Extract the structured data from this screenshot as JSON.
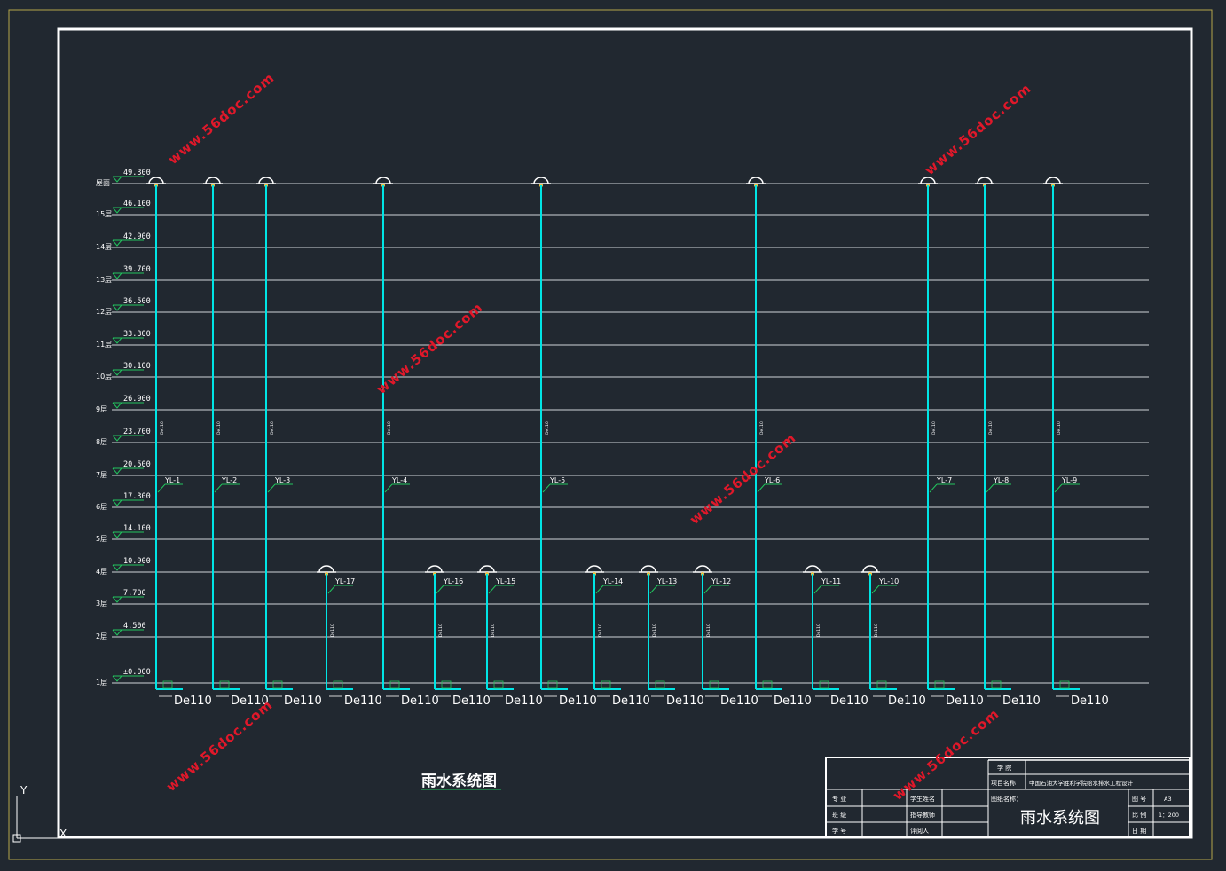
{
  "title": "雨水系统图",
  "elev_labels": [
    "49.300",
    "46.100",
    "42.900",
    "39.700",
    "36.500",
    "33.300",
    "30.100",
    "26.900",
    "23.700",
    "20.500",
    "17.300",
    "14.100",
    "10.900",
    "7.700",
    "4.500",
    "±0.000"
  ],
  "floor_labels": [
    "屋面",
    "15层",
    "14层",
    "13层",
    "12层",
    "11层",
    "10层",
    "9层",
    "8层",
    "7层",
    "6层",
    "5层",
    "4层",
    "3层",
    "2层",
    "1层"
  ],
  "tall_pipes": [
    {
      "label": "YL-1",
      "dn": "De110"
    },
    {
      "label": "YL-2",
      "dn": "De110"
    },
    {
      "label": "YL-3",
      "dn": "De110"
    },
    {
      "label": "YL-4",
      "dn": "De110"
    },
    {
      "label": "YL-5",
      "dn": "De110"
    },
    {
      "label": "YL-6",
      "dn": "De110"
    },
    {
      "label": "YL-7",
      "dn": "De110"
    },
    {
      "label": "YL-8",
      "dn": "De110"
    },
    {
      "label": "YL-9",
      "dn": "De110"
    }
  ],
  "short_pipes": [
    {
      "label": "YL-17",
      "dn": "De110"
    },
    {
      "label": "YL-16",
      "dn": "De110"
    },
    {
      "label": "YL-15",
      "dn": "De110"
    },
    {
      "label": "YL-14",
      "dn": "De110"
    },
    {
      "label": "YL-13",
      "dn": "De110"
    },
    {
      "label": "YL-12",
      "dn": "De110"
    },
    {
      "label": "YL-11",
      "dn": "De110"
    },
    {
      "label": "YL-10",
      "dn": "De110"
    }
  ],
  "bottom_labels": [
    "De110",
    "De110",
    "De110",
    "De110",
    "De110",
    "De110",
    "De110",
    "De110",
    "De110",
    "De110",
    "De110",
    "De110",
    "De110",
    "De110",
    "De110",
    "De110",
    "De110"
  ],
  "watermark": "www.56doc.com",
  "title_block": {
    "school": "学 院",
    "project_name_label": "项目名称",
    "project_name": "中国石油大学胜利学院给水排水工程设计",
    "drawing_name_label": "图纸名称：",
    "drawing_name": "雨水系统图",
    "major": "专 业",
    "class": "班 级",
    "student_no": "学 号",
    "student_name": "学生姓名",
    "teacher": "指导教师",
    "reviewer": "评阅人",
    "drawing_no": "图 号",
    "drawing_no_value": "A3",
    "scale": "比 例",
    "scale_value": "1：200",
    "date": "日 期"
  },
  "ucs": {
    "y": "Y",
    "x": "X"
  },
  "colors": {
    "bg": "#212830",
    "pipe": "#00e5e5",
    "label": "#22c55e",
    "frame": "#ffffff",
    "watermark": "#e0182a"
  }
}
